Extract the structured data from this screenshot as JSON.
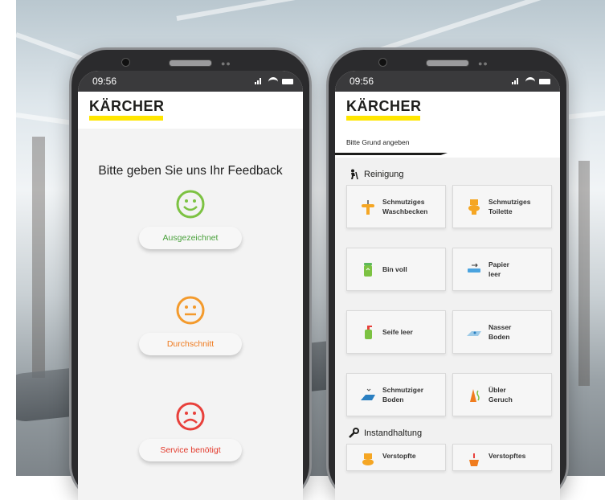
{
  "left_phone": {
    "time": "09:56",
    "logo": "KÄRCHER",
    "title": "Bitte geben Sie uns Ihr Feedback",
    "options": [
      {
        "label": "Ausgezeichnet"
      },
      {
        "label": "Durchschnitt"
      },
      {
        "label": "Service benötigt"
      }
    ]
  },
  "right_phone": {
    "time": "09:56",
    "logo": "KÄRCHER",
    "tab": "Bitte Grund angeben",
    "sections": [
      {
        "title": "Reinigung",
        "icon": "cleaning-person-icon"
      },
      {
        "title": "Instandhaltung",
        "icon": "wrench-icon"
      }
    ],
    "cleaning_items": [
      {
        "label1": "Schmutziges",
        "label2": "Waschbecken",
        "icon": "sink-icon"
      },
      {
        "label1": "Schmutziges",
        "label2": "Toilette",
        "icon": "toilet-icon"
      },
      {
        "label1": "Bin voll",
        "label2": "",
        "icon": "bin-icon"
      },
      {
        "label1": "Papier",
        "label2": "leer",
        "icon": "paper-icon"
      },
      {
        "label1": "Seife leer",
        "label2": "",
        "icon": "soap-icon"
      },
      {
        "label1": "Nasser",
        "label2": "Boden",
        "icon": "wet-floor-icon"
      },
      {
        "label1": "Schmutziger",
        "label2": "Boden",
        "icon": "dirty-floor-icon"
      },
      {
        "label1": "Übler",
        "label2": "Geruch",
        "icon": "smell-icon"
      }
    ],
    "maintenance_items": [
      {
        "label1": "Verstopfte",
        "icon": "clogged-toilet-icon"
      },
      {
        "label1": "Verstopftes",
        "icon": "clogged-sink-icon"
      }
    ]
  },
  "colors": {
    "brand_yellow": "#ffe600",
    "good_green": "#4aa13c",
    "mid_orange": "#ef7a1e",
    "bad_red": "#e33a2c"
  }
}
